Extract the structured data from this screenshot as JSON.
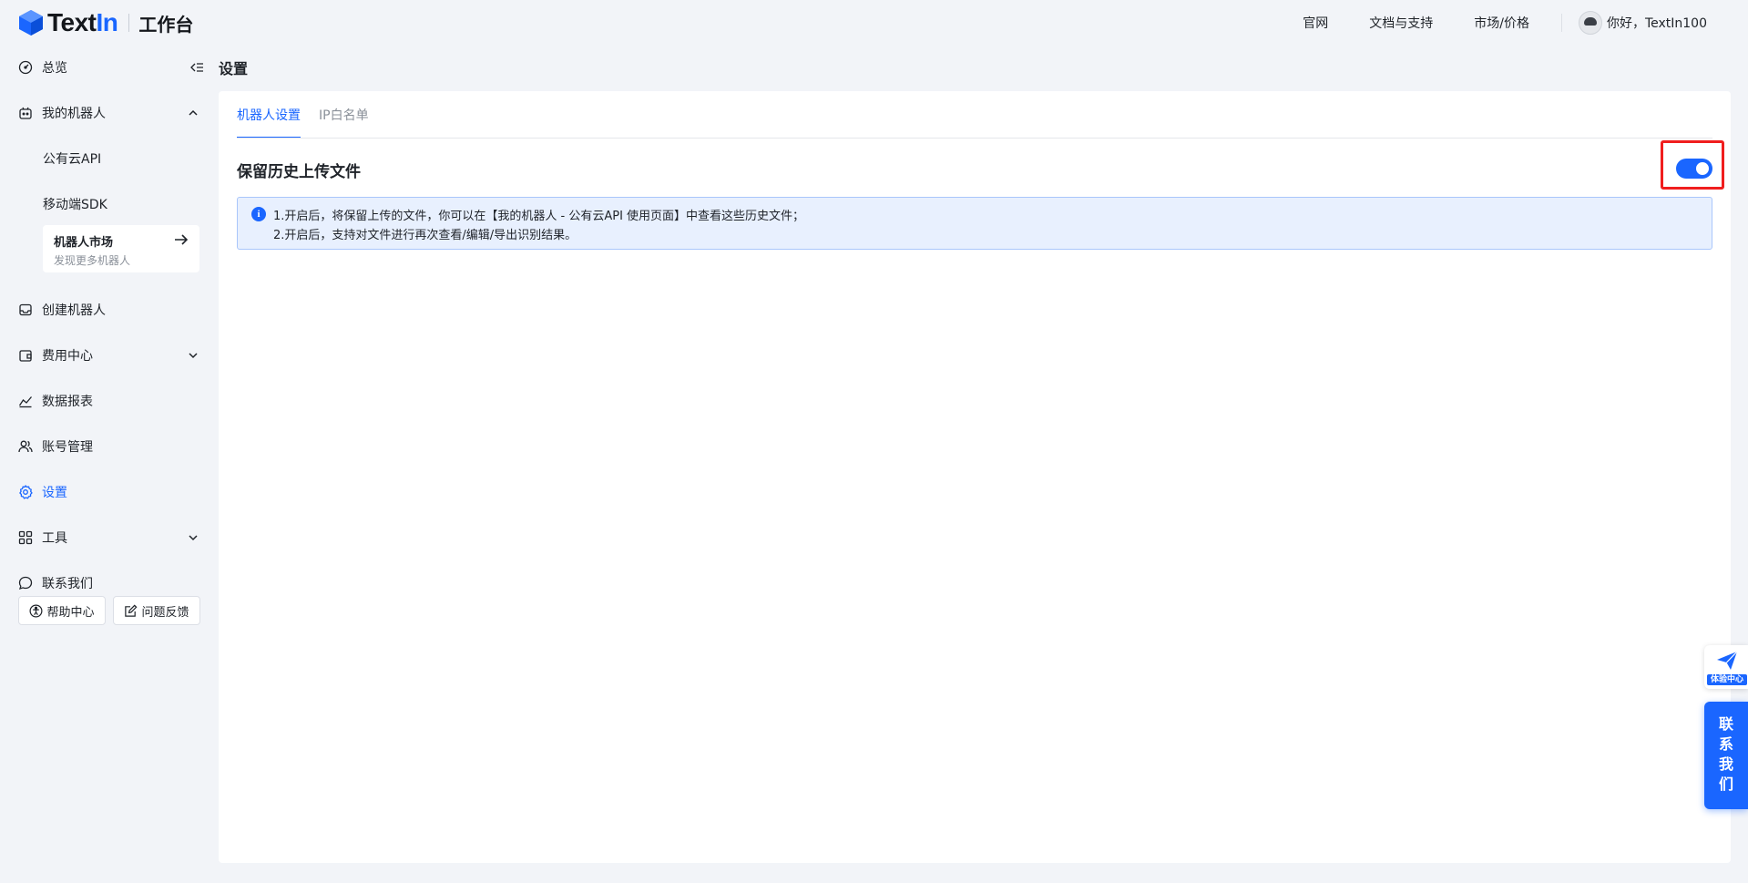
{
  "header": {
    "logo_text_a": "Text",
    "logo_text_b": "In",
    "subtitle": "工作台",
    "nav": [
      "官网",
      "文档与支持",
      "市场/价格"
    ],
    "greeting": "你好，TextIn100"
  },
  "sidebar": {
    "overview": "总览",
    "my_robots": "我的机器人",
    "public_api": "公有云API",
    "mobile_sdk": "移动端SDK",
    "market_title": "机器人市场",
    "market_desc": "发现更多机器人",
    "create_robot": "创建机器人",
    "billing": "费用中心",
    "reports": "数据报表",
    "accounts": "账号管理",
    "settings": "设置",
    "tools": "工具",
    "contact": "联系我们",
    "help_center": "帮助中心",
    "feedback": "问题反馈"
  },
  "main": {
    "page_title": "设置",
    "tabs": [
      "机器人设置",
      "IP白名单"
    ],
    "setting_title": "保留历史上传文件",
    "toggle_on": true,
    "info_lines": [
      "1.开启后，将保留上传的文件，你可以在【我的机器人 - 公有云API 使用页面】中查看这些历史文件；",
      "2.开启后，支持对文件进行再次查看/编辑/导出识别结果。"
    ]
  },
  "floating": {
    "experience": "体验中心",
    "contact": "联系我们"
  },
  "colors": {
    "accent": "#1a66ff",
    "highlight": "#f01e1e",
    "background": "#f2f4f8"
  }
}
